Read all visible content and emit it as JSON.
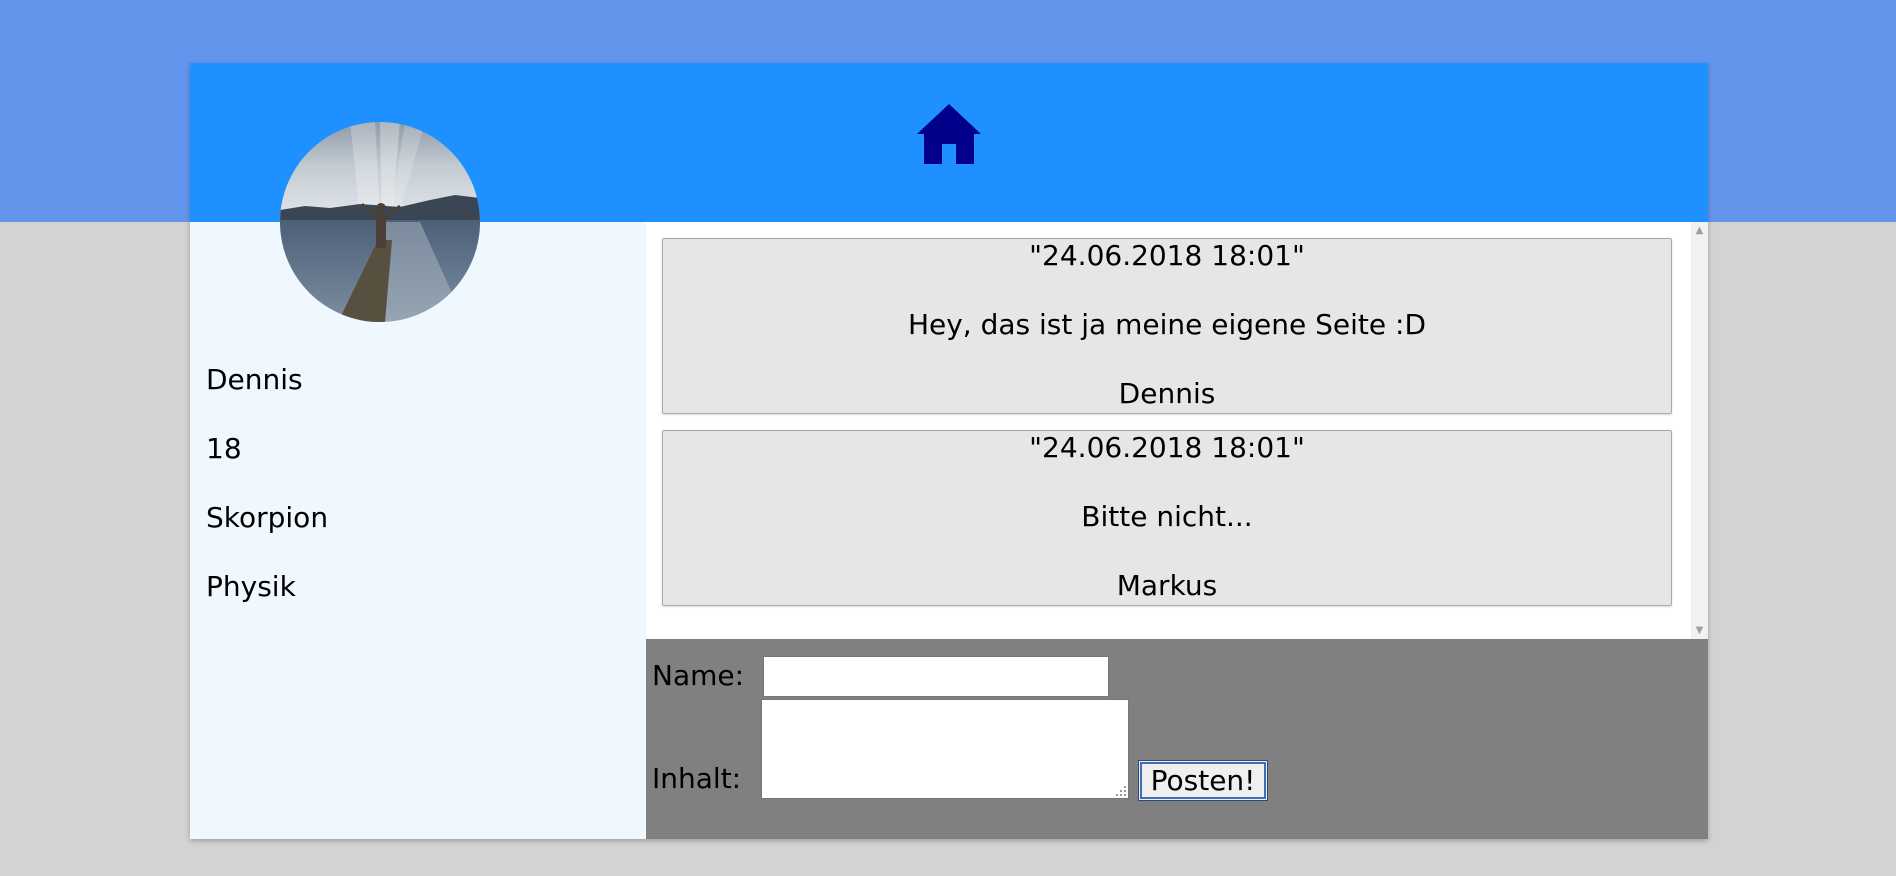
{
  "profile": {
    "name": "Dennis",
    "age": "18",
    "zodiac": "Skorpion",
    "subject": "Physik",
    "avatar_alt": "Profilbild"
  },
  "header": {
    "home_icon": "home-icon"
  },
  "posts": [
    {
      "date": "\"24.06.2018 18:01\"",
      "content": "Hey, das ist ja meine eigene Seite :D",
      "author": "Dennis"
    },
    {
      "date": "\"24.06.2018 18:01\"",
      "content": "Bitte nicht...",
      "author": "Markus"
    }
  ],
  "form": {
    "name_label": "Name:",
    "name_value": "",
    "content_label": "Inhalt:",
    "content_value": "",
    "submit_label": "Posten!"
  },
  "colors": {
    "page_background": "#d3d3d3",
    "top_band": "#6495ed",
    "header": "#1e90ff",
    "home_icon": "#00008b",
    "sidebar": "#f0f8ff",
    "post_background": "#e6e6e6",
    "form_background": "#808080"
  }
}
